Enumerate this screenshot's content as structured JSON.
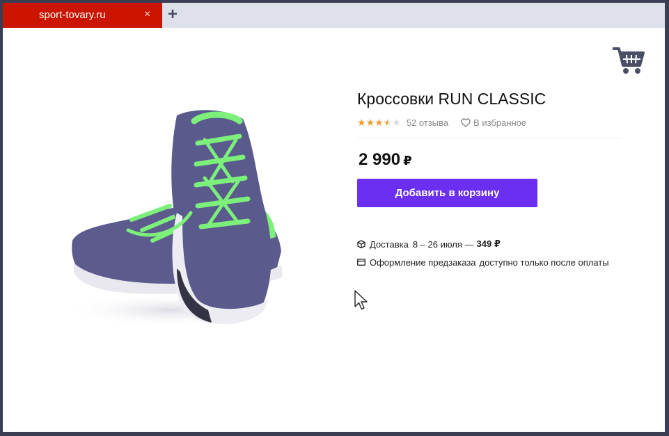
{
  "browser": {
    "tab_title": "sport-tovary.ru",
    "tab_close": "×",
    "new_tab": "+"
  },
  "header": {
    "cart_icon": "shopping-cart-icon"
  },
  "product": {
    "title": "Кроссовки RUN CLASSIC",
    "rating": 3.5,
    "rating_max": 5,
    "reviews": "52 отзыва",
    "favorite_label": "В избранное",
    "price": "2 990",
    "currency": "₽",
    "add_to_cart": "Добавить в корзину"
  },
  "delivery": {
    "label": "Доставка",
    "dates": "8 – 26 июля —",
    "price": "349 ₽"
  },
  "preorder": {
    "label": "Оформление предзаказа",
    "note": "доступно только после оплаты"
  },
  "colors": {
    "tab_bg": "#cc1500",
    "button_bg": "#6b2ff2",
    "star": "#f09a2a",
    "shoe_body": "#5a5a8c",
    "shoe_accent": "#7cf07a"
  }
}
